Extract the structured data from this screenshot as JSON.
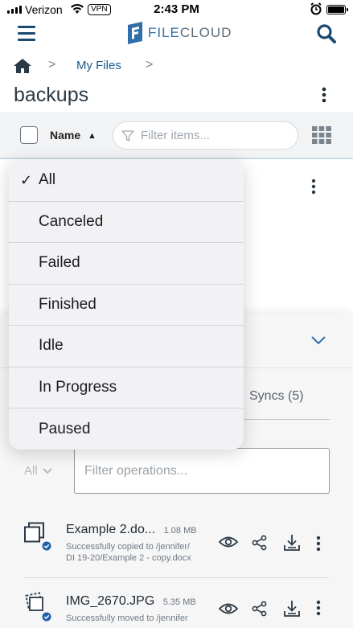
{
  "statusbar": {
    "carrier": "Verizon",
    "vpn": "VPN",
    "time": "2:43 PM"
  },
  "header": {
    "logo_prefix": "FILE",
    "logo_suffix": "CLOUD"
  },
  "breadcrumb": {
    "current": "My Files"
  },
  "folder": {
    "title": "backups"
  },
  "toolbar": {
    "sort_label": "Name",
    "filter_placeholder": "Filter items..."
  },
  "status_menu": {
    "selected": "All",
    "options": [
      "All",
      "Canceled",
      "Failed",
      "Finished",
      "Idle",
      "In Progress",
      "Paused"
    ]
  },
  "activity": {
    "syncs_tab": "Syncs (5)",
    "status_filter": "All",
    "filter_placeholder": "Filter operations...",
    "operations": [
      {
        "name": "Example 2.do...",
        "size": "1.08 MB",
        "desc_line1": "Successfully copied to /jennifer/",
        "desc_line2": "DI 19-20/Example 2 - copy.docx",
        "icon": "copy-icon"
      },
      {
        "name": "IMG_2670.JPG",
        "size": "5.35 MB",
        "desc_line1": "Successfully moved to /jennifer",
        "desc_line2": "",
        "icon": "move-icon"
      }
    ]
  },
  "colors": {
    "brand": "#2f6ea9",
    "link": "#1a5a8a",
    "status_ok": "#1f5fa8"
  }
}
